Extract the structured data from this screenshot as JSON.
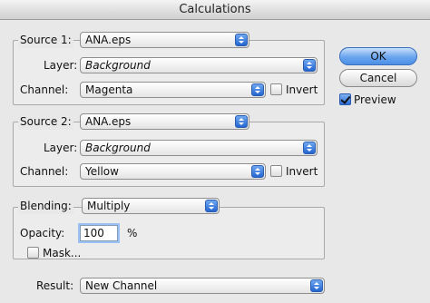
{
  "window": {
    "title": "Calculations"
  },
  "source1": {
    "label": "Source 1:",
    "file": "ANA.eps",
    "layer_label": "Layer:",
    "layer": "Background",
    "channel_label": "Channel:",
    "channel": "Magenta",
    "invert_label": "Invert",
    "invert_checked": false
  },
  "source2": {
    "label": "Source 2:",
    "file": "ANA.eps",
    "layer_label": "Layer:",
    "layer": "Background",
    "channel_label": "Channel:",
    "channel": "Yellow",
    "invert_label": "Invert",
    "invert_checked": false
  },
  "blending": {
    "label": "Blending:",
    "mode": "Multiply",
    "opacity_label": "Opacity:",
    "opacity": "100",
    "opacity_unit": "%",
    "mask_label": "Mask...",
    "mask_checked": false
  },
  "result": {
    "label": "Result:",
    "value": "New Channel"
  },
  "buttons": {
    "ok": "OK",
    "cancel": "Cancel"
  },
  "preview": {
    "label": "Preview",
    "checked": true
  },
  "colors": {
    "accent": "#2466d1",
    "focus_ring": "#9cc2f5"
  }
}
